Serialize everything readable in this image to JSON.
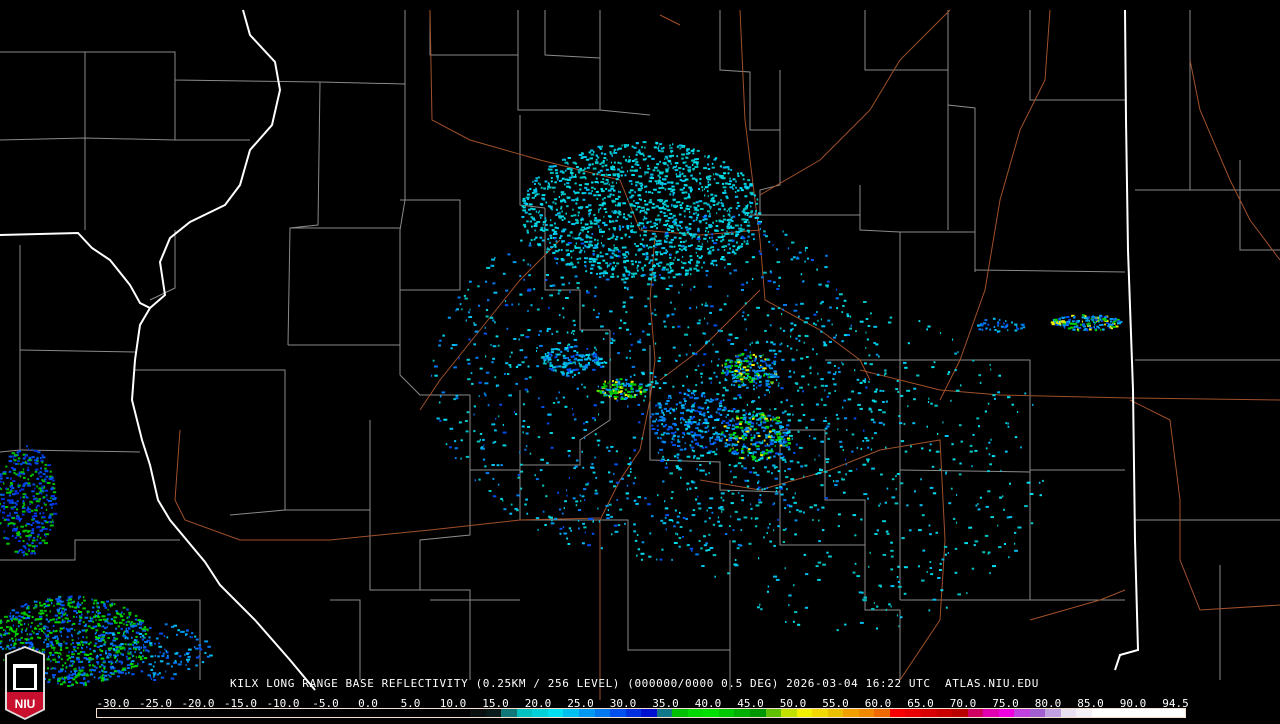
{
  "caption": {
    "title": "KILX LONG RANGE BASE REFLECTIVITY (0.25KM / 256 LEVEL) (000000/0000 0.5 DEG) 2026-03-04 16:22 UTC",
    "site": "ATLAS.NIU.EDU"
  },
  "logo": {
    "text": "NIU"
  },
  "colorbar": {
    "labels": [
      "-30.0",
      "-25.0",
      "-20.0",
      "-15.0",
      "-10.0",
      "-5.0",
      "0.0",
      "5.0",
      "10.0",
      "15.0",
      "20.0",
      "25.0",
      "30.0",
      "35.0",
      "40.0",
      "45.0",
      "50.0",
      "55.0",
      "60.0",
      "65.0",
      "70.0",
      "75.0",
      "80.0",
      "85.0",
      "90.0",
      "94.5"
    ],
    "colors": [
      "#000000",
      "#000000",
      "#000000",
      "#000000",
      "#000000",
      "#000000",
      "#000000",
      "#000000",
      "#000000",
      "#000000",
      "#000000",
      "#000000",
      "#000000",
      "#000000",
      "#000000",
      "#000000",
      "#000000",
      "#000000",
      "#000000",
      "#000000",
      "#000000",
      "#000000",
      "#000000",
      "#000000",
      "#0a1010",
      "#0a1a1a",
      "#107878",
      "#00c0c0",
      "#00d0d8",
      "#00e0f0",
      "#00c0f0",
      "#0098f0",
      "#0078f0",
      "#0050f0",
      "#0030e0",
      "#0010d0",
      "#107888",
      "#00c000",
      "#00d800",
      "#00e000",
      "#00c800",
      "#00b000",
      "#009800",
      "#60c000",
      "#c0e000",
      "#f0f000",
      "#f0d800",
      "#e8c000",
      "#f0a000",
      "#f08800",
      "#f06800",
      "#f80000",
      "#e80000",
      "#d80000",
      "#c80000",
      "#b80000",
      "#d00060",
      "#e000b0",
      "#f000e0",
      "#c040e0",
      "#a060d0",
      "#c0a0e0",
      "#e8e0f0",
      "#f4f0f8",
      "#ffffff",
      "#ffffff",
      "#ffffff",
      "#ffffff",
      "#ffffff",
      "#ffffff"
    ]
  },
  "map_colors": {
    "county": "#8a8a8a",
    "state": "#ffffff",
    "road": "#a0502a"
  }
}
